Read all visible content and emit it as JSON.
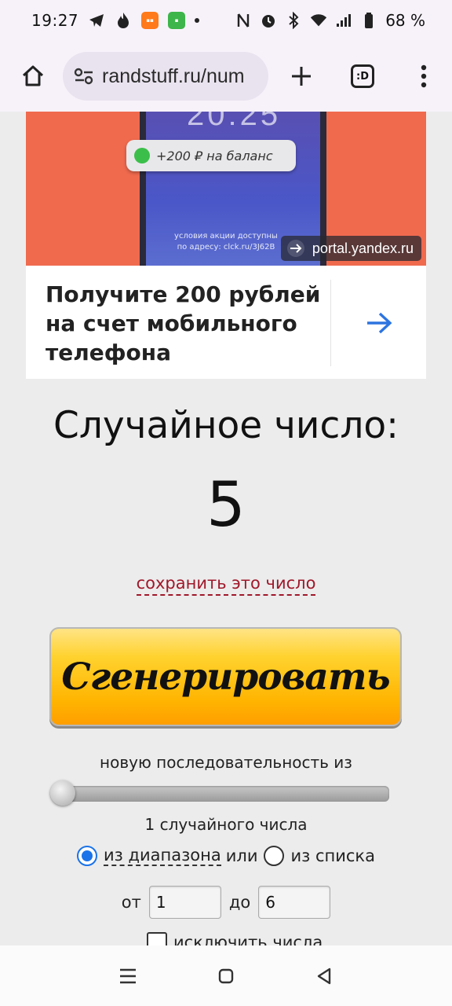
{
  "status_bar": {
    "time": "19:27",
    "battery": "68 %",
    "icons": [
      "telegram-icon",
      "flame-icon",
      "app-badge-icon",
      "app-badge-icon",
      "dot-icon",
      "nfc-icon",
      "alarm-icon",
      "bluetooth-icon",
      "wifi-icon",
      "signal-icon",
      "battery-icon"
    ]
  },
  "browser": {
    "url": "randstuff.ru/num",
    "tab_badge": ":D"
  },
  "ad": {
    "notification_text": "+200 ₽ на баланс",
    "terms_text": "условия акции доступны по адресу: clck.ru/3J62B",
    "domain": "portal.yandex.ru",
    "title": "Получите 200 рублей на счет мобильного телефона",
    "accent_color": "#f06a4e"
  },
  "main": {
    "heading": "Случайное число:",
    "result": "5",
    "save_link": "сохранить это число",
    "generate_button": "Сгенерировать",
    "sequence_label": "новую последовательность из",
    "count_label": "1 случайного числа",
    "mode": {
      "range_label": "из диапазона",
      "or_label": "или",
      "list_label": "из списка",
      "selected": "range"
    },
    "range": {
      "from_label": "от",
      "from_value": "1",
      "to_label": "до",
      "to_value": "6"
    },
    "exclude_label": "исключить числа",
    "slider_value": 1
  },
  "colors": {
    "link": "#a0182a",
    "radio_selected": "#1a73e8",
    "button": "#ffc000"
  }
}
